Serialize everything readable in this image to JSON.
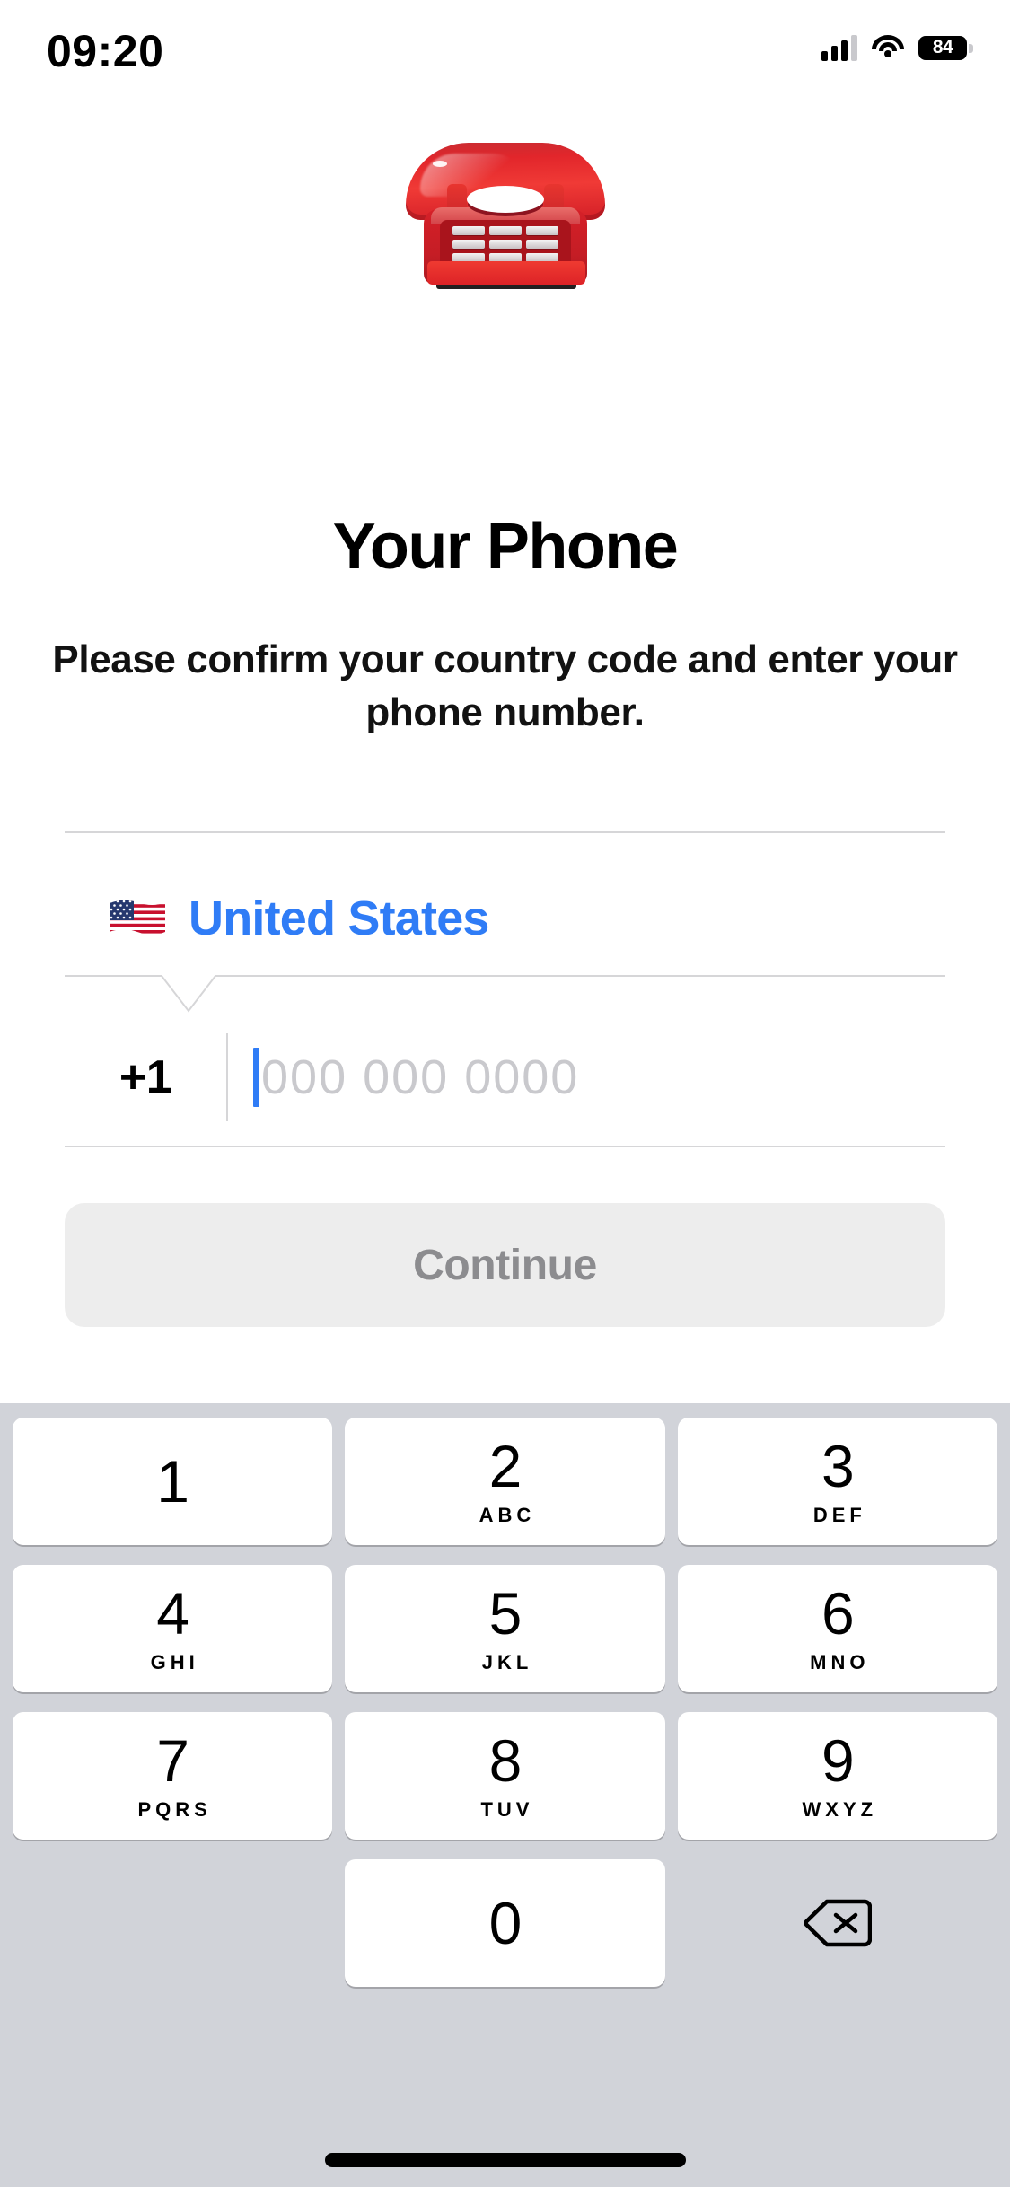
{
  "status_bar": {
    "time": "09:20",
    "battery_percent": "84",
    "signal_icon": "cellular-bars-icon",
    "wifi_icon": "wifi-icon",
    "battery_icon": "battery-icon"
  },
  "hero": {
    "icon": "telephone-emoji",
    "emoji": "☎️"
  },
  "page": {
    "title": "Your Phone",
    "subtitle": "Please confirm your country code and enter your phone number."
  },
  "form": {
    "country": {
      "flag_icon": "us-flag-emoji",
      "name": "United States"
    },
    "dial_code": "+1",
    "phone_placeholder": "000 000 0000",
    "phone_value": ""
  },
  "actions": {
    "continue_label": "Continue"
  },
  "keypad": {
    "keys": [
      {
        "digit": "1",
        "letters": ""
      },
      {
        "digit": "2",
        "letters": "ABC"
      },
      {
        "digit": "3",
        "letters": "DEF"
      },
      {
        "digit": "4",
        "letters": "GHI"
      },
      {
        "digit": "5",
        "letters": "JKL"
      },
      {
        "digit": "6",
        "letters": "MNO"
      },
      {
        "digit": "7",
        "letters": "PQRS"
      },
      {
        "digit": "8",
        "letters": "TUV"
      },
      {
        "digit": "9",
        "letters": "WXYZ"
      },
      {
        "digit": "0",
        "letters": ""
      }
    ],
    "delete_icon": "backspace-delete-icon"
  },
  "colors": {
    "accent_blue": "#2F7CF6",
    "placeholder_gray": "#c9c9cd",
    "button_disabled_bg": "#ededed",
    "button_disabled_text": "#8c8c8f",
    "keyboard_bg": "#d1d3d9",
    "key_bg": "#ffffff",
    "divider": "#d6d6d8",
    "emoji_red": "#d52028"
  }
}
